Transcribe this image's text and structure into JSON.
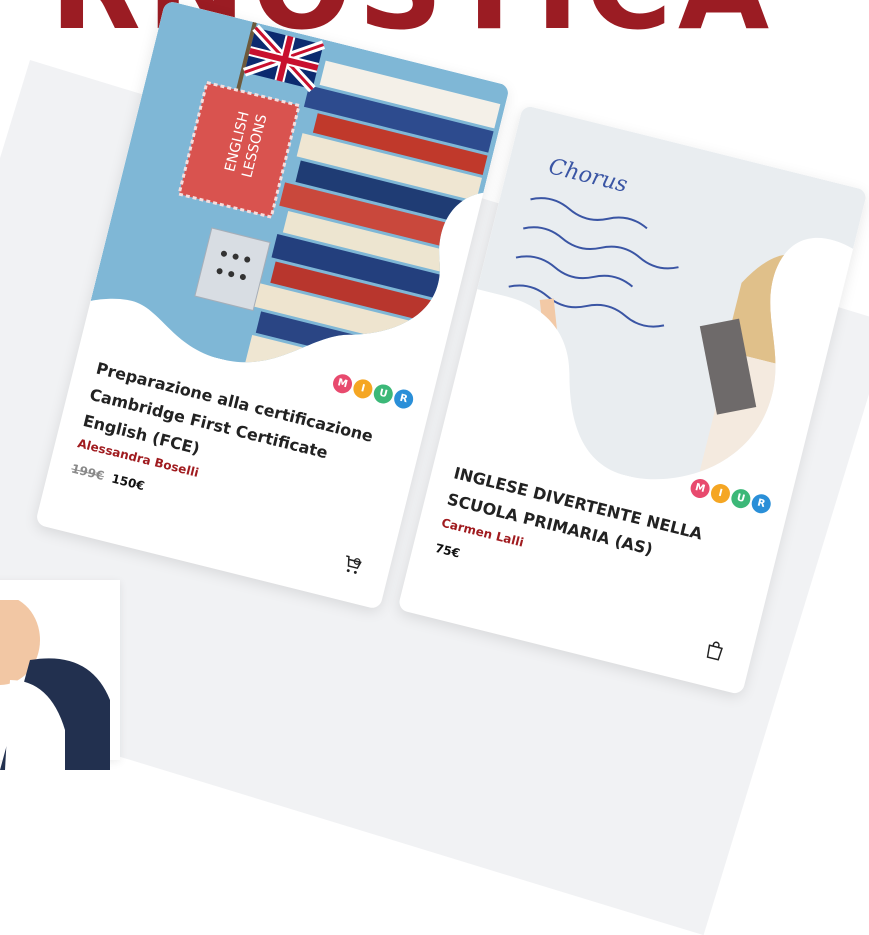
{
  "hero": {
    "word": "RNOSTICA"
  },
  "courses": [
    {
      "title": "Preparazione alla certificazione Cambridge First Certificate English (FCE)",
      "author": "Alessandra Boselli",
      "price_old": "199€",
      "price": "150€",
      "cart_icon": "cart-add-icon",
      "flag_text_1": "ENGLISH",
      "flag_text_2": "LESSONS"
    },
    {
      "title": "INGLESE DIVERTENTE NELLA SCUOLA PRIMARIA (AS)",
      "author": "Carmen Lalli",
      "price": "75€",
      "cart_icon": "shopping-bag-icon",
      "board_text": "Chorus"
    }
  ],
  "badge": {
    "letters": [
      "M",
      "I",
      "U",
      "R"
    ]
  },
  "colors": {
    "accent": "#9b1c23",
    "author": "#a01b1f",
    "band": "#f1f2f4"
  }
}
